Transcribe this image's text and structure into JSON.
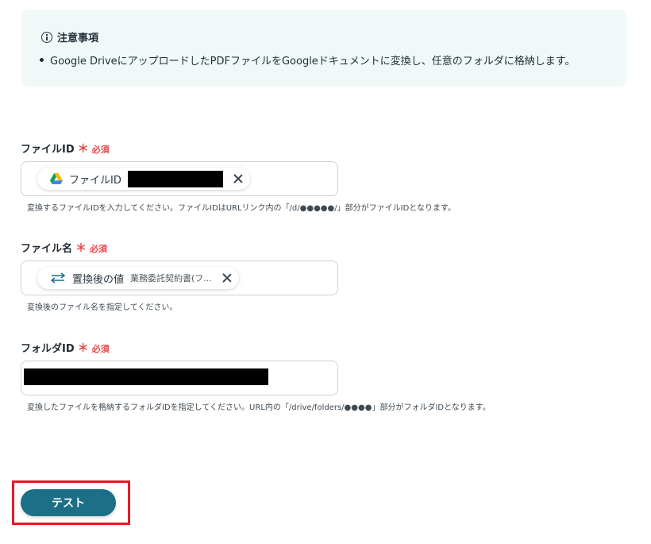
{
  "notice": {
    "title": "注意事項",
    "item": "Google DriveにアップロードしたPDFファイルをGoogleドキュメントに変換し、任意のフォルダに格納します。"
  },
  "fields": {
    "file_id": {
      "label": "ファイルID",
      "required_mark": "＊",
      "required_text": "必須",
      "chip_label": "ファイルID",
      "help": "変換するファイルIDを入力してください。ファイルIDはURLリンク内の「/d/●●●●●/」部分がファイルIDとなります。"
    },
    "file_name": {
      "label": "ファイル名",
      "required_mark": "＊",
      "required_text": "必須",
      "chip_label": "置換後の値",
      "chip_sub": "業務委託契約書(フ...",
      "help": "変換後のファイル名を指定してください。"
    },
    "folder_id": {
      "label": "フォルダID",
      "required_mark": "＊",
      "required_text": "必須",
      "help": "変換したファイルを格納するフォルダIDを指定してください。URL内の「/drive/folders/●●●●」部分がフォルダIDとなります。"
    }
  },
  "actions": {
    "test_label": "テスト"
  },
  "colors": {
    "accent": "#1b6f87",
    "required": "#e5484d",
    "highlight": "#e01b24",
    "notice_bg": "#f0f9f8"
  },
  "icons": [
    "info-icon",
    "google-drive-icon",
    "swap-arrows-icon",
    "close-icon"
  ]
}
